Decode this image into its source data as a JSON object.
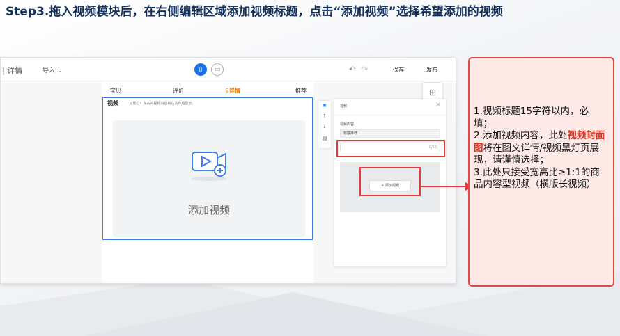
{
  "heading": "Step3.拖入视频模块后，在右侧编辑区域添加视频标题，点击“添加视频”选择希望添加的视频",
  "editor": {
    "topbar": {
      "breadcrumb": "| 详情",
      "import_label": "导入",
      "save_label": "保存",
      "publish_label": "发布"
    },
    "tabs": [
      {
        "label": "宝贝"
      },
      {
        "label": "评价"
      },
      {
        "label": "详情"
      },
      {
        "label": "推荐"
      }
    ],
    "video_module": {
      "title": "视频",
      "note": "◎放心！真实的视频内容将在发布后显示。",
      "add_label": "添加视频"
    },
    "panel": {
      "title": "视频",
      "content_label": "视频内容",
      "tag_value": "穿搭推荐",
      "counter": "0/15",
      "add_button": "+ 添加视频"
    }
  },
  "callout": {
    "line1": "1.视频标题15字符以内，必填；",
    "line2_prefix": "2.添加视频内容，此处",
    "line2_highlight": "视频封面图",
    "line2_suffix": "将在图文详情/视频黑灯页展现，请谨慎选择；",
    "line3": "3.此处只接受宽高比≥1:1的商品内容型视频（横版长视频）"
  },
  "colors": {
    "heading": "#13315c",
    "highlight_red": "#e13a3a",
    "module_border": "#3f7fe6",
    "active_tab": "#f57a00"
  }
}
